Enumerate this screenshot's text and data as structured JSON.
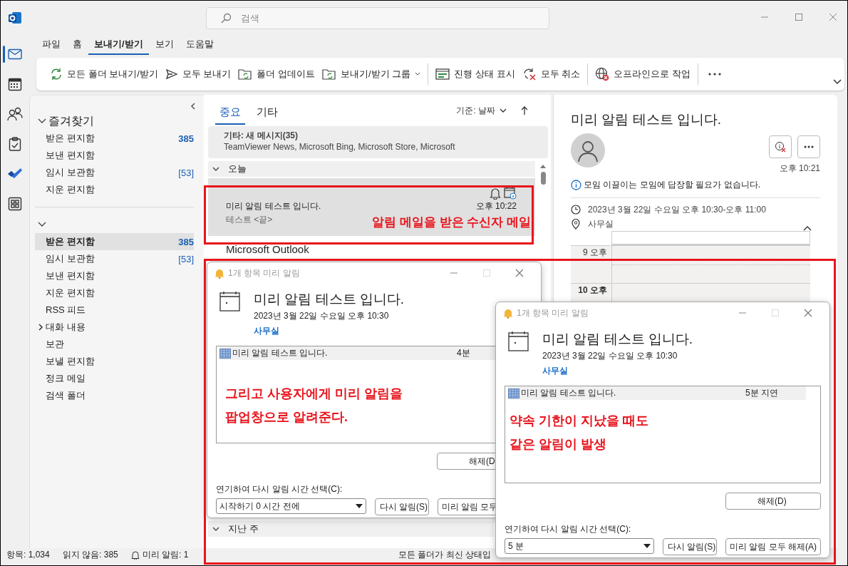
{
  "search": {
    "placeholder": "검색"
  },
  "rail": [
    {
      "kind": "mail",
      "selected": true
    },
    {
      "kind": "calendar",
      "selected": false
    },
    {
      "kind": "people",
      "selected": false
    },
    {
      "kind": "tasks",
      "selected": false
    },
    {
      "kind": "todo",
      "selected": false
    },
    {
      "kind": "apps",
      "selected": false
    }
  ],
  "menu_tabs": [
    {
      "label": "파일",
      "selected": false
    },
    {
      "label": "홈",
      "selected": false
    },
    {
      "label": "보내기/받기",
      "selected": true
    },
    {
      "label": "보기",
      "selected": false
    },
    {
      "label": "도움말",
      "selected": false
    }
  ],
  "ribbon": [
    {
      "label": "모든 폴더 보내기/받기",
      "kind": "sync",
      "dropdown": false
    },
    {
      "label": "모두 보내기",
      "kind": "send",
      "dropdown": false
    },
    {
      "label": "폴더 업데이트",
      "kind": "folder",
      "dropdown": false
    },
    {
      "label": "보내기/받기 그룹",
      "kind": "folder",
      "dropdown": true
    },
    {
      "kind": "separator"
    },
    {
      "label": "진행 상태 표시",
      "kind": "progress",
      "dropdown": false
    },
    {
      "label": "모두 취소",
      "kind": "cancel",
      "dropdown": false
    },
    {
      "kind": "separator"
    },
    {
      "label": "오프라인으로 작업",
      "kind": "offline",
      "dropdown": false
    }
  ],
  "nav": {
    "favorites": {
      "title": "즐겨찾기",
      "expanded": true,
      "items": [
        {
          "label": "받은 편지함",
          "count": "385",
          "kind": "unread",
          "selected": false
        },
        {
          "label": "보낸 편지함",
          "selected": false
        },
        {
          "label": "임시 보관함",
          "count": "[53]",
          "kind": "drafts",
          "selected": false
        },
        {
          "label": "지운 편지함",
          "selected": false
        }
      ]
    },
    "account": {
      "expanded": true,
      "items": [
        {
          "label": "받은 편지함",
          "count": "385",
          "kind": "unread",
          "selected": true
        },
        {
          "label": "임시 보관함",
          "count": "[53]",
          "kind": "drafts",
          "selected": false
        },
        {
          "label": "보낸 편지함",
          "selected": false
        },
        {
          "label": "지운 편지함",
          "selected": false
        },
        {
          "label": "RSS 피드",
          "selected": false
        },
        {
          "label": "대화 내용",
          "expanded": false,
          "selected": false
        },
        {
          "label": "보관",
          "selected": false
        },
        {
          "label": "보낼 편지함",
          "selected": false
        },
        {
          "label": "정크 메일",
          "selected": false
        },
        {
          "label": "검색 폴더",
          "selected": false
        }
      ]
    }
  },
  "list": {
    "tabs": [
      {
        "label": "중요",
        "selected": true
      },
      {
        "label": "기타",
        "selected": false
      }
    ],
    "sort": "기준: 날짜",
    "other_banner": {
      "title": "기타: 새 메시지(35)",
      "senders": "TeamViewer News, Microsoft Bing, Microsoft Store, Microsoft"
    },
    "groups": [
      {
        "label": "오늘",
        "expanded": true,
        "messages": [
          {
            "kind": "meeting",
            "subject": "미리 알림 테스트 입니다.",
            "preview": "테스트 <끝>",
            "time": "오후 10:22",
            "note": "알림 메일을 받은 수신자 메일",
            "selected": true
          },
          {
            "kind": "mail",
            "sender": "Microsoft Outlook",
            "selected": false
          }
        ]
      },
      {
        "label": "지난 주",
        "expanded": true
      }
    ]
  },
  "reading": {
    "title": "미리 알림 테스트 입니다.",
    "time": "오후 10:21",
    "info": "모임 이끌이는 모임에 답장할 필요가 없습니다.",
    "when": "2023년 3월 22일 수요일 오후 10:30-오후 11:00",
    "where": "사무실",
    "hours": [
      {
        "label": "9 오후",
        "current": false
      },
      {
        "label": "10 오후",
        "current": true
      }
    ]
  },
  "reminders": [
    {
      "window_title": "1개 항목 미리 알림",
      "subject": "미리 알림 테스트 입니다.",
      "when": "2023년 3월 22일 수요일 오후 10:30",
      "location": "사무실",
      "rows": [
        {
          "subject": "미리 알림 테스트 입니다.",
          "due": "4분"
        }
      ],
      "note": [
        "그리고 사용자에게 미리 알림을",
        "팝업창으로 알려준다."
      ],
      "dismiss": "해제(D",
      "snooze_label": "연기하여 다시 알림 시간 선택(C):",
      "snooze_value": "시작하기 0 시간 전에",
      "snooze": "다시 알림(S)",
      "dismiss_all": "미리 알림 모두"
    },
    {
      "window_title": "1개 항목 미리 알림",
      "subject": "미리 알림 테스트 입니다.",
      "when": "2023년 3월 22일 수요일 오후 10:30",
      "location": "사무실",
      "rows": [
        {
          "subject": "미리 알림 테스트 입니다.",
          "due": "5분 지연"
        }
      ],
      "note": [
        "약속 기한이 지났을 때도",
        "같은 알림이 발생"
      ],
      "dismiss": "해제(D)",
      "snooze_label": "연기하여 다시 알림 시간 선택(C):",
      "snooze_value": "5 분",
      "snooze": "다시 알림(S)",
      "dismiss_all": "미리 알림 모두 해제(A)"
    }
  ],
  "status": {
    "items": "항목: 1,034",
    "unread": "읽지 않음: 385",
    "reminders": "미리 알림: 1",
    "sync": "모든 폴더가 최신 상태입"
  }
}
